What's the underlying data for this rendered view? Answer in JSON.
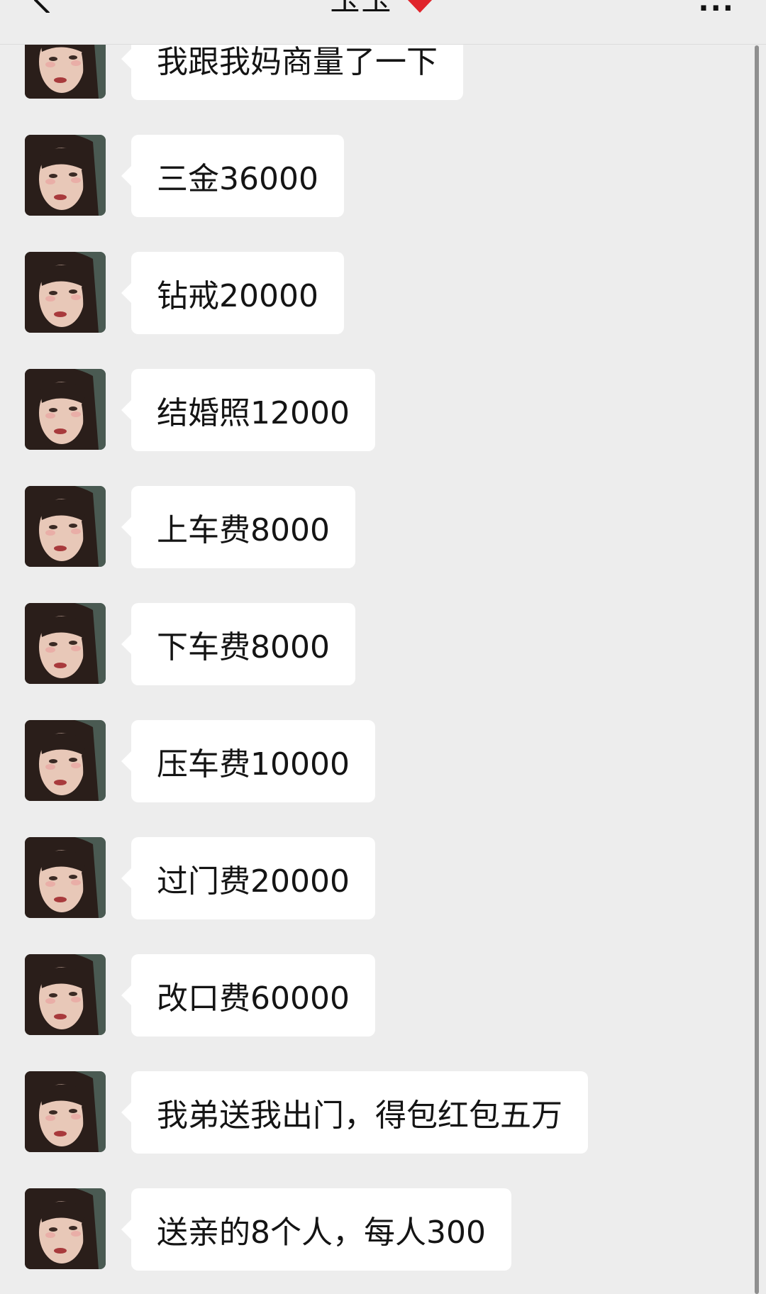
{
  "header": {
    "contact_name": "玉玉",
    "heart_icon": "red-heart-icon",
    "back_icon": "chevron-left-icon",
    "more_icon": "more-dots-icon",
    "more_label": "···"
  },
  "messages": [
    {
      "text": "我跟我妈商量了一下"
    },
    {
      "text": "三金36000"
    },
    {
      "text": "钻戒20000"
    },
    {
      "text": "结婚照12000"
    },
    {
      "text": "上车费8000"
    },
    {
      "text": "下车费8000"
    },
    {
      "text": "压车费10000"
    },
    {
      "text": "过门费20000"
    },
    {
      "text": "改口费60000"
    },
    {
      "text": "我弟送我出门，得包红包五万"
    },
    {
      "text": "送亲的8个人，每人300"
    }
  ],
  "colors": {
    "background": "#ededed",
    "bubble": "#ffffff",
    "text": "#141414",
    "heart": "#e0242b"
  }
}
